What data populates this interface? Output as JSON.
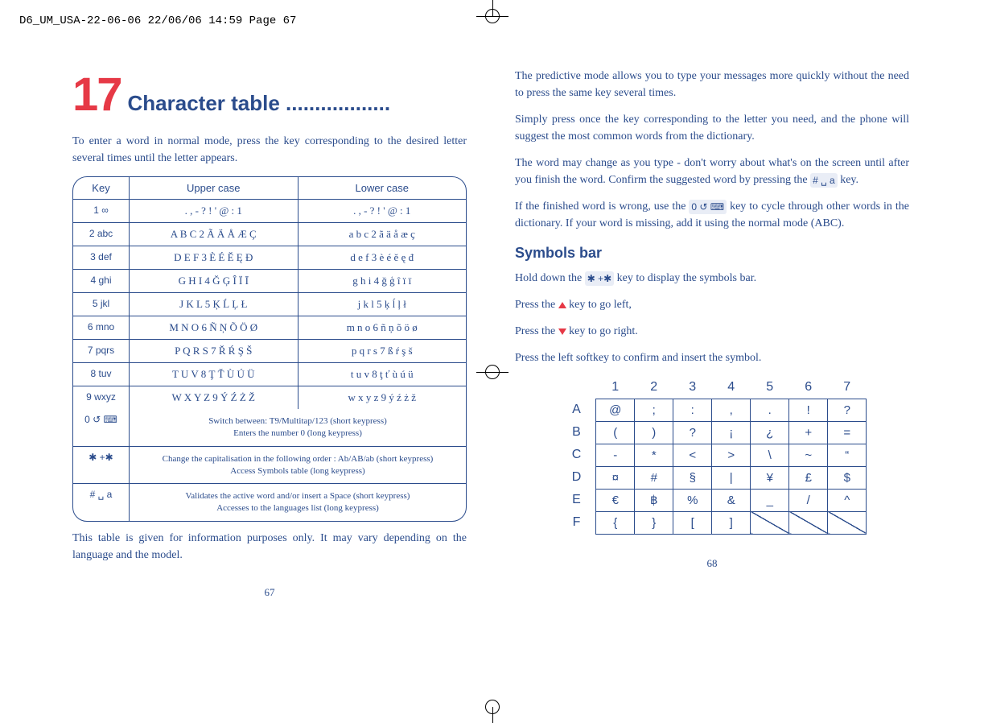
{
  "header_strip": "D6_UM_USA-22-06-06  22/06/06  14:59  Page 67",
  "left": {
    "chapter_number": "17",
    "chapter_title": "Character table ..................",
    "intro": "To enter a word in normal mode, press the key corresponding to the desired letter several times until the letter appears.",
    "table_headers": {
      "key": "Key",
      "upper": "Upper case",
      "lower": "Lower case"
    },
    "rows": [
      {
        "key": "1 ∞",
        "upper": ". , - ? ! ' @ : 1",
        "lower": ". , - ? ! ' @ : 1"
      },
      {
        "key": "2 abc",
        "upper": "A B C 2 Ã Ä Å Æ Ç",
        "lower": "a b c 2 ã ä å æ ç"
      },
      {
        "key": "3 def",
        "upper": "D E F 3 È É Ě Ę Đ",
        "lower": "d e f 3 è é ě ę đ"
      },
      {
        "key": "4 ghi",
        "upper": "G H I 4 Ğ Ģ Î Ï Ī",
        "lower": "g h i 4 ğ ģ î ï ī"
      },
      {
        "key": "5 jkl",
        "upper": "J K L 5 Ķ Ĺ Ļ Ł",
        "lower": "j k l 5 ķ ĺ ļ ł"
      },
      {
        "key": "6 mno",
        "upper": "M N O 6 Ñ Ņ Õ Ö Ø",
        "lower": "m n o 6 ñ ņ õ ö ø"
      },
      {
        "key": "7 pqrs",
        "upper": "P Q R S 7 Ř Ŕ Ş Š",
        "lower": "p q r s 7 ß ŕ ş š"
      },
      {
        "key": "8 tuv",
        "upper": "T U V 8 Ţ Ť Ù Ú Ü",
        "lower": "t u v 8 ţ ť ù ú ü"
      },
      {
        "key": "9 wxyz",
        "upper": "W X Y Z 9 Ý Ź Ż Ž",
        "lower": "w x y z 9 ý ź ż ž"
      }
    ],
    "wide_rows": [
      {
        "key": "0 ↺ ⌨",
        "line1": "Switch between: T9/Multitap/123 (short keypress)",
        "line2": "Enters the number 0 (long keypress)"
      },
      {
        "key": "✱ +✱",
        "line1": "Change the capitalisation in the following order : Ab/AB/ab (short keypress)",
        "line2": "Access Symbols table (long keypress)"
      },
      {
        "key": "# ␣ a",
        "line1": "Validates the active word and/or insert a Space (short keypress)",
        "line2": "Accesses to the languages list (long keypress)"
      }
    ],
    "footnote": "This table is given for information purposes only. It may vary depending on the language and the model.",
    "page_num": "67"
  },
  "right": {
    "para1": "The predictive mode allows you to type your messages more quickly without the need to press the same key several times.",
    "para2": "Simply press once the key corresponding to the letter you need, and the phone will suggest the most common words from the dictionary.",
    "para3_a": "The word may change as you type - don't worry about what's on the screen until after you finish the word. Confirm the suggested word by pressing the ",
    "para3_key": "# ␣ a",
    "para3_b": " key.",
    "para4_a": "If the finished word is wrong, use the ",
    "para4_key": "0 ↺ ⌨",
    "para4_b": " key to cycle through other words in the dictionary. If your word is missing, add it using the normal mode (ABC).",
    "subheading": "Symbols bar",
    "sb1_a": "Hold down the ",
    "sb1_key": "✱ +✱",
    "sb1_b": " key to display the symbols bar.",
    "sb2_a": "Press the ",
    "sb2_b": " key to go left,",
    "sb3_a": "Press the ",
    "sb3_b": " key to go right.",
    "sb4": "Press the left softkey to confirm and insert the symbol.",
    "grid": {
      "cols": [
        "1",
        "2",
        "3",
        "4",
        "5",
        "6",
        "7"
      ],
      "rows": [
        "A",
        "B",
        "C",
        "D",
        "E",
        "F"
      ],
      "cells": [
        [
          "@",
          ";",
          ":",
          ",",
          ".",
          "!",
          "?"
        ],
        [
          "(",
          ")",
          "?",
          "¡",
          "¿",
          "+",
          "="
        ],
        [
          "-",
          "*",
          "<",
          ">",
          "\\",
          "~",
          "“"
        ],
        [
          "¤",
          "#",
          "§",
          "|",
          "¥",
          "£",
          "$"
        ],
        [
          "€",
          "฿",
          "%",
          "&",
          "_",
          "/",
          "^"
        ],
        [
          "{",
          "}",
          "[",
          "]",
          "",
          "",
          ""
        ]
      ],
      "diagonals": [
        [
          5,
          4
        ],
        [
          5,
          5
        ],
        [
          5,
          6
        ]
      ]
    },
    "page_num": "68"
  }
}
